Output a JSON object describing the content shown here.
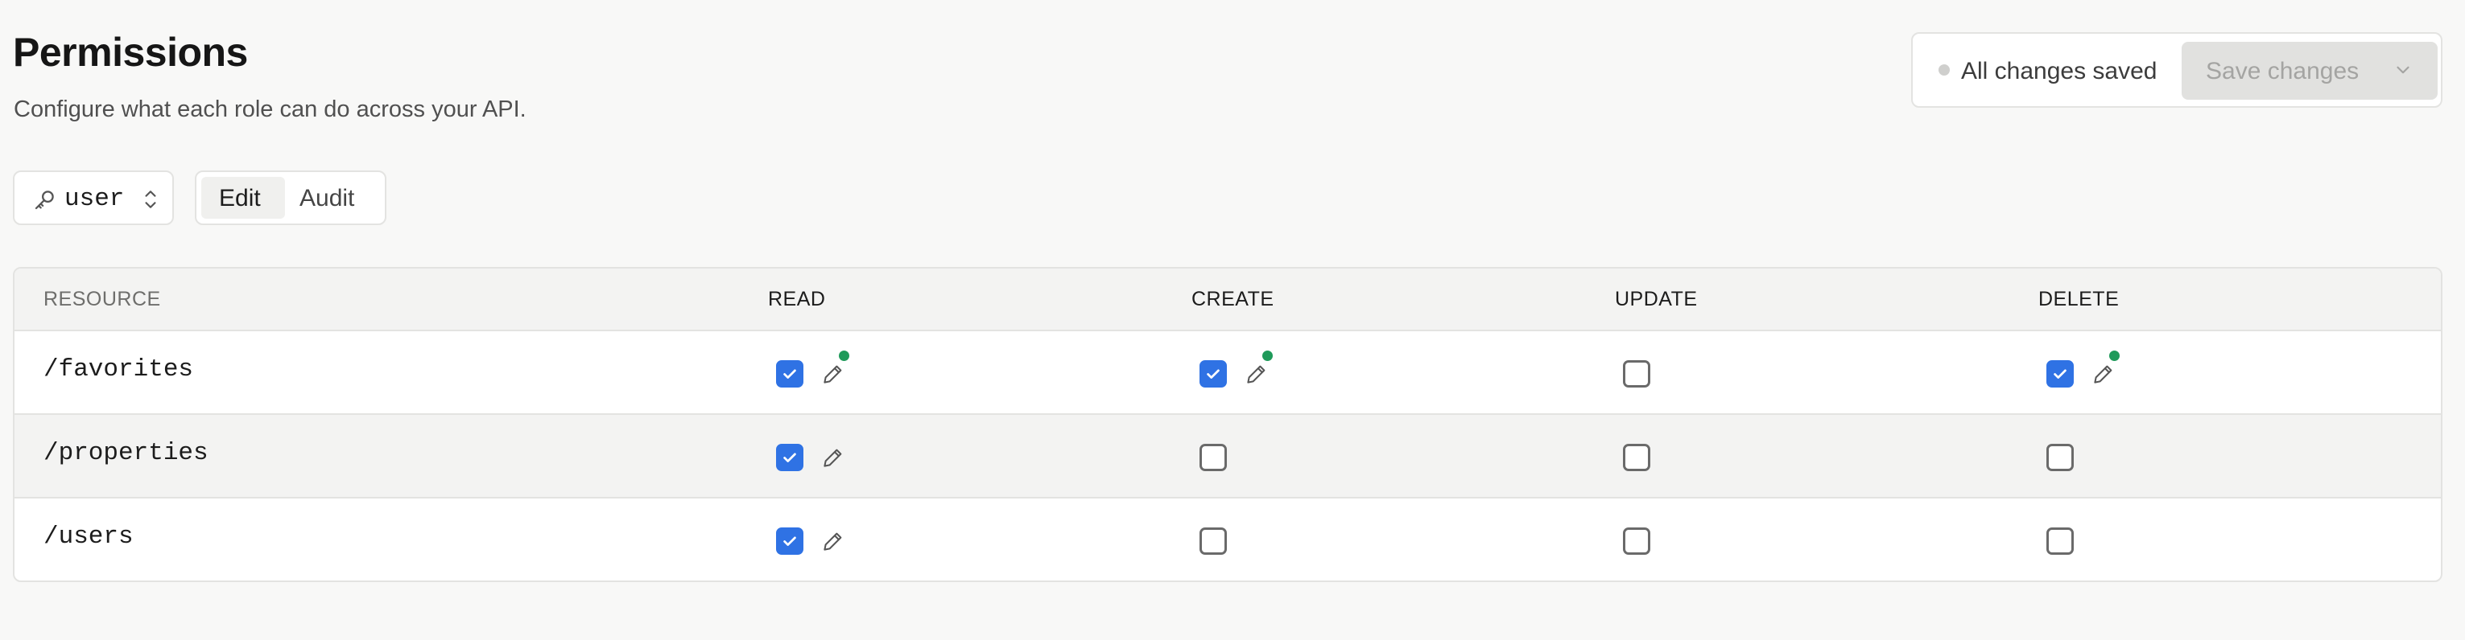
{
  "header": {
    "title": "Permissions",
    "subtitle": "Configure what each role can do across your API."
  },
  "save_panel": {
    "status_text": "All changes saved",
    "save_label": "Save changes",
    "status_dot_color": "#cfcfcd"
  },
  "role_select": {
    "icon": "key-icon",
    "value": "user"
  },
  "mode_tabs": [
    {
      "label": "Edit",
      "active": true
    },
    {
      "label": "Audit",
      "active": false
    }
  ],
  "table": {
    "columns": [
      "RESOURCE",
      "READ",
      "CREATE",
      "UPDATE",
      "DELETE"
    ],
    "rows": [
      {
        "resource": "/favorites",
        "read": {
          "checked": true,
          "edit_icon": true,
          "changed": true
        },
        "create": {
          "checked": true,
          "edit_icon": true,
          "changed": true
        },
        "update": {
          "checked": false,
          "edit_icon": false,
          "changed": false
        },
        "delete": {
          "checked": true,
          "edit_icon": true,
          "changed": true
        }
      },
      {
        "resource": "/properties",
        "read": {
          "checked": true,
          "edit_icon": true,
          "changed": false
        },
        "create": {
          "checked": false,
          "edit_icon": false,
          "changed": false
        },
        "update": {
          "checked": false,
          "edit_icon": false,
          "changed": false
        },
        "delete": {
          "checked": false,
          "edit_icon": false,
          "changed": false
        }
      },
      {
        "resource": "/users",
        "read": {
          "checked": true,
          "edit_icon": true,
          "changed": false
        },
        "create": {
          "checked": false,
          "edit_icon": false,
          "changed": false
        },
        "update": {
          "checked": false,
          "edit_icon": false,
          "changed": false
        },
        "delete": {
          "checked": false,
          "edit_icon": false,
          "changed": false
        }
      }
    ]
  },
  "colors": {
    "accent": "#2f72e4",
    "changed_indicator": "#1f9a5a",
    "background": "#f8f8f7"
  }
}
